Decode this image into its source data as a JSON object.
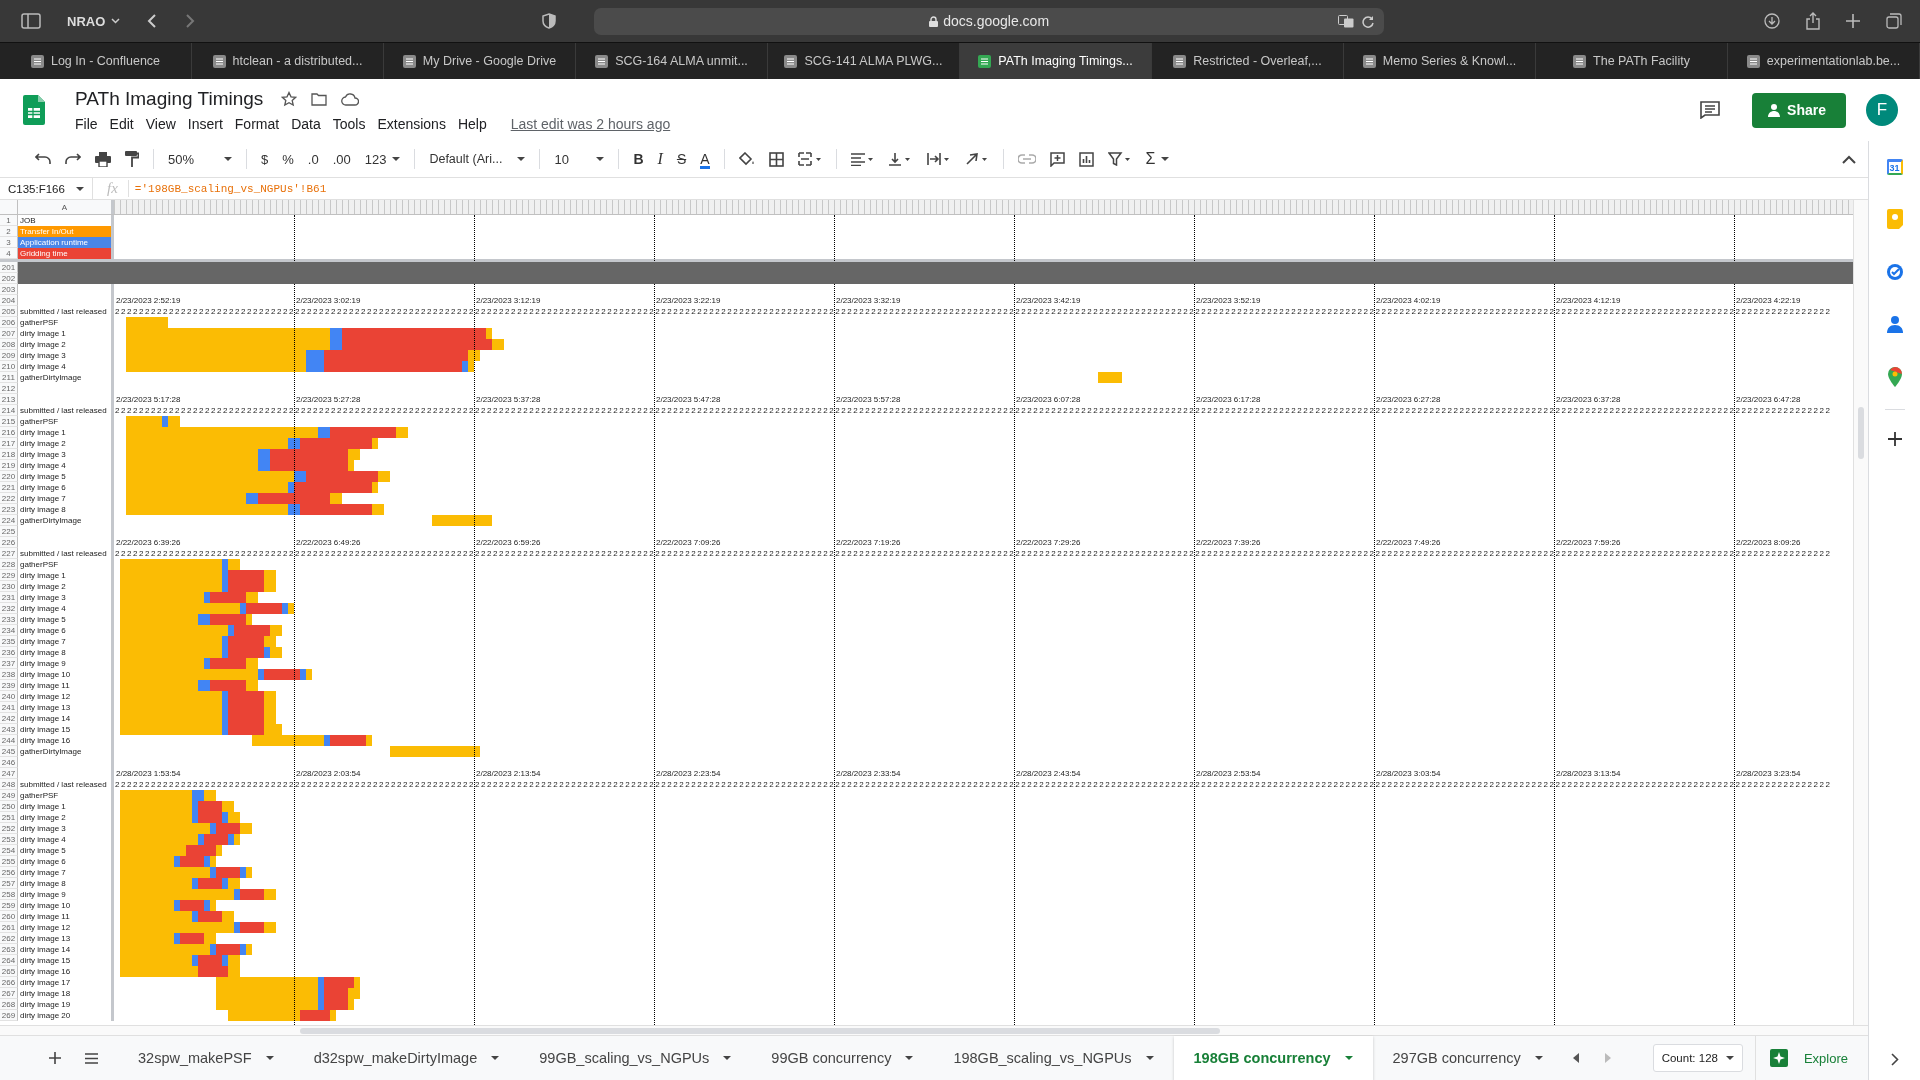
{
  "browser": {
    "profile": "NRAO",
    "url": "docs.google.com",
    "tabs": [
      {
        "title": "Log In - Confluence",
        "selected": false
      },
      {
        "title": "htclean - a distributed...",
        "selected": false
      },
      {
        "title": "My Drive - Google Drive",
        "selected": false
      },
      {
        "title": "SCG-164 ALMA unmit...",
        "selected": false
      },
      {
        "title": "SCG-141 ALMA PLWG...",
        "selected": false
      },
      {
        "title": "PATh Imaging Timings...",
        "selected": true
      },
      {
        "title": "Restricted - Overleaf,...",
        "selected": false
      },
      {
        "title": "Memo Series & Knowl...",
        "selected": false
      },
      {
        "title": "The PATh Facility",
        "selected": false
      },
      {
        "title": "experimentationlab.be...",
        "selected": false
      }
    ]
  },
  "doc": {
    "title": "PATh Imaging Timings",
    "menus": [
      "File",
      "Edit",
      "View",
      "Insert",
      "Format",
      "Data",
      "Tools",
      "Extensions",
      "Help"
    ],
    "last_edit": "Last edit was 2 hours ago",
    "share": "Share",
    "avatar": "F"
  },
  "toolbar": {
    "zoom": "50%",
    "currency": "$",
    "percent": "%",
    "dec_less": ".0",
    "dec_more": ".00",
    "number_format": "123",
    "font": "Default (Ari...",
    "font_size": "10",
    "bold": "B",
    "italic": "I",
    "strike": "S",
    "text_color": "A",
    "sum": "Σ"
  },
  "formula_bar": {
    "cell_ref": "C135:F166",
    "fx": "fx",
    "formula": "='198GB_scaling_vs_NGPUs'!B61"
  },
  "sheet": {
    "column_a": "A",
    "legend": [
      {
        "num": "1",
        "label": "JOB"
      },
      {
        "num": "2",
        "label": "Transfer In/Out",
        "color": "#ff9900"
      },
      {
        "num": "3",
        "label": "Application runtime",
        "color": "#4a86e8"
      },
      {
        "num": "4",
        "label": "Gridding time",
        "color": "#ea4335"
      }
    ],
    "top_rows": [
      {
        "num": "201",
        "kind": "band"
      },
      {
        "num": "202",
        "kind": "band"
      },
      {
        "num": "203",
        "kind": "blank"
      }
    ],
    "blocks": [
      {
        "date_row": "204",
        "timestamps": [
          "2/23/2023 2:52:19",
          "2/23/2023 3:02:19",
          "2/23/2023 3:12:19",
          "2/23/2023 3:22:19",
          "2/23/2023 3:32:19",
          "2/23/2023 3:42:19",
          "2/23/2023 3:52:19",
          "2/23/2023 4:02:19",
          "2/23/2023 4:12:19",
          "2/23/2023 4:22:19"
        ],
        "counts_row": "205",
        "counts_label": "submitted / last released",
        "counts": "2 2 2 2 2 2 2 2 2 2 2 2 2 2 2 2 2 2 2 2 2 2 2 2 2 2 2 2 2 2 2 2 2 2 2 2 2 2 2 2 2 2 2 2 2 2 2 2 2 2 2 2 2 2 2 2 2 2 2 2 2 2 2 2 2 2 2 2 2 2 2 2 2 2 2 2 2 2 2 2 2 2 2 2 2 2 2 2 2 2 2 2 2 2 2 2 2 2 2 2 2 2 2 2 2 2 2 2 2 2 2 2 2 2 2 2 2 2 2 2 2 2 2 2 2 2 2 2 2 2 2 2 2 2 2 2 2 2 2 2 2 2 2 2 2 2 2 2 2 2 2 2 2 2 2 2 2 2 2 2 2 2 2 2 2 2 2 2 2 2 2 2 2 2 2 2 2 2 2 2 2 2 2 2 2 2 2 2 2 2 2 2 2 2 2 2 2 2 2 2 2 2 2 2 2 2 2 2 2 2 2 2 2 2 2 2 2 2 2 2 2 2 2 2 2 2 2 2 2 2 2 2 2 2 2 2 2 2 2 2 2 2 2 2 2 2 2 2 2 2 2 2 2 2 2 2 2 2 2 2 2 2 2 2 2 2 2 2 2 2 2 2 2 2 2 2 2 2 2 2 2 2 2 2 2 2",
        "bar_rows": [
          {
            "num": "206",
            "label": "gatherPSF"
          },
          {
            "num": "207",
            "label": "dirty image 1"
          },
          {
            "num": "208",
            "label": "dirty image 2"
          },
          {
            "num": "209",
            "label": "dirty image 3"
          },
          {
            "num": "210",
            "label": "dirty image 4"
          },
          {
            "num": "211",
            "label": "gatherDirtyImage"
          }
        ],
        "blank_row": "212"
      },
      {
        "date_row": "213",
        "timestamps": [
          "2/23/2023 5:17:28",
          "2/23/2023 5:27:28",
          "2/23/2023 5:37:28",
          "2/23/2023 5:47:28",
          "2/23/2023 5:57:28",
          "2/23/2023 6:07:28",
          "2/23/2023 6:17:28",
          "2/23/2023 6:27:28",
          "2/23/2023 6:37:28",
          "2/23/2023 6:47:28"
        ],
        "counts_row": "214",
        "counts_label": "submitted / last released",
        "counts": "2 2 2 2 2 2 2 2 2 2 2 2 2 2 2 2 2 2 2 2 2 2 2 2 2 2 2 2 2 2 2 2 2 2 2 2 2 2 2 2 2 2 2 2 2 2 2 2 2 2 2 2 2 2 2 2 2 2 2 2 2 2 2 2 2 2 2 2 2 2 2 2 2 2 2 2 2 2 2 2 2 2 2 2 2 2 2 2 2 2 2 2 2 2 2 2 2 2 2 2 2 2 2 2 2 2 2 2 2 2 2 2 2 2 2 2 2 2 2 2 2 2 2 2 2 2 2 2 2 2 2 2 2 2 2 2 2 2 2 2 2 2 2 2 2 2 2 2 2 2 2 2 2 2 2 2 2 2 2 2 2 2 2 2 2 2 2 2 2 2 2 2 2 2 2 2 2 2 2 2 2 2 2 2 2 2 2 2 2 2 2 2 2 2 2 2 2 2 2 2 2 2 2 2 2 2 2 2 2 2 2 2 2 2 2 2 2 2 2 2 2 2 2 2 2 2 2 2 2 2 2 2 2 2 2 2 2 2 2 2 2 2 2 2 2 2 2 2 2 2 2 2 2 2 2 2 2 2 2 2 2 2 2 2 2 2 2 2 2 2 2 2 2 2 2 2 2 2 2 2 2 2 2 2 2 2",
        "bar_rows": [
          {
            "num": "215",
            "label": "gatherPSF"
          },
          {
            "num": "216",
            "label": "dirty image 1"
          },
          {
            "num": "217",
            "label": "dirty image 2"
          },
          {
            "num": "218",
            "label": "dirty image 3"
          },
          {
            "num": "219",
            "label": "dirty image 4"
          },
          {
            "num": "220",
            "label": "dirty image 5"
          },
          {
            "num": "221",
            "label": "dirty image 6"
          },
          {
            "num": "222",
            "label": "dirty image 7"
          },
          {
            "num": "223",
            "label": "dirty image 8"
          },
          {
            "num": "224",
            "label": "gatherDirtyImage"
          }
        ],
        "blank_row": "225"
      },
      {
        "date_row": "226",
        "timestamps": [
          "2/22/2023 6:39:26",
          "2/22/2023 6:49:26",
          "2/22/2023 6:59:26",
          "2/22/2023 7:09:26",
          "2/22/2023 7:19:26",
          "2/22/2023 7:29:26",
          "2/22/2023 7:39:26",
          "2/22/2023 7:49:26",
          "2/22/2023 7:59:26",
          "2/22/2023 8:09:26"
        ],
        "counts_row": "227",
        "counts_label": "submitted / last released",
        "counts": "2 2 2 2 2 2 2 2 2 2 2 2 2 2 2 2 2 2 2 2 2 2 2 2 2 2 2 2 2 2 2 2 2 2 2 2 2 2 2 2 2 2 2 2 2 2 2 2 2 2 2 2 2 2 2 2 2 2 2 2 2 2 2 2 2 2 2 2 2 2 2 2 2 2 2 2 2 2 2 2 2 2 2 2 2 2 2 2 2 2 2 2 2 2 2 2 2 2 2 2 2 2 2 2 2 2 2 2 2 2 2 2 2 2 2 2 2 2 2 2 2 2 2 2 2 2 2 2 2 2 2 2 2 2 2 2 2 2 2 2 2 2 2 2 2 2 2 2 2 2 2 2 2 2 2 2 2 2 2 2 2 2 2 2 2 2 2 2 2 2 2 2 2 2 2 2 2 2 2 2 2 2 2 2 2 2 2 2 2 2 2 2 2 2 2 2 2 2 2 2 2 2 2 2 2 2 2 2 2 2 2 2 2 2 2 2 2 2 2 2 2 2 2 2 2 2 2 2 2 2 2 2 2 2 2 2 2 2 2 2 2 2 2 2 2 2 2 2 2 2 2 2 2 2 2 2 2 2 2 2 2 2 2 2 2 2 2 2 2 2 2 2 2 2 2 2 2 2 2 2 2 2 2 2 2 2",
        "bar_rows": [
          {
            "num": "228",
            "label": "gatherPSF"
          },
          {
            "num": "229",
            "label": "dirty image 1"
          },
          {
            "num": "230",
            "label": "dirty image 2"
          },
          {
            "num": "231",
            "label": "dirty image 3"
          },
          {
            "num": "232",
            "label": "dirty image 4"
          },
          {
            "num": "233",
            "label": "dirty image 5"
          },
          {
            "num": "234",
            "label": "dirty image 6"
          },
          {
            "num": "235",
            "label": "dirty image 7"
          },
          {
            "num": "236",
            "label": "dirty image 8"
          },
          {
            "num": "237",
            "label": "dirty image 9"
          },
          {
            "num": "238",
            "label": "dirty image 10"
          },
          {
            "num": "239",
            "label": "dirty image 11"
          },
          {
            "num": "240",
            "label": "dirty image 12"
          },
          {
            "num": "241",
            "label": "dirty image 13"
          },
          {
            "num": "242",
            "label": "dirty image 14"
          },
          {
            "num": "243",
            "label": "dirty image 15"
          },
          {
            "num": "244",
            "label": "dirty image 16"
          },
          {
            "num": "245",
            "label": "gatherDirtyImage"
          }
        ],
        "blank_row": "246"
      },
      {
        "date_row": "247",
        "timestamps": [
          "2/28/2023 1:53:54",
          "2/28/2023 2:03:54",
          "2/28/2023 2:13:54",
          "2/28/2023 2:23:54",
          "2/28/2023 2:33:54",
          "2/28/2023 2:43:54",
          "2/28/2023 2:53:54",
          "2/28/2023 3:03:54",
          "2/28/2023 3:13:54",
          "2/28/2023 3:23:54"
        ],
        "counts_row": "248",
        "counts_label": "submitted / last released",
        "counts": "2 2 2 2 2 2 2 2 2 2 2 2 2 2 2 2 2 2 2 2 2 2 2 2 2 2 2 2 2 2 2 2 2 2 2 2 2 2 2 2 2 2 2 2 2 2 2 2 2 2 2 2 2 2 2 2 2 2 2 2 2 2 2 2 2 2 2 2 2 2 2 2 2 2 2 2 2 2 2 2 2 2 2 2 2 2 2 2 2 2 2 2 2 2 2 2 2 2 2 2 2 2 2 2 2 2 2 2 2 2 2 2 2 2 2 2 2 2 2 2 2 2 2 2 2 2 2 2 2 2 2 2 2 2 2 2 2 2 2 2 2 2 2 2 2 2 2 2 2 2 2 2 2 2 2 2 2 2 2 2 2 2 2 2 2 2 2 2 2 2 2 2 2 2 2 2 2 2 2 2 2 2 2 2 2 2 2 2 2 2 2 2 2 2 2 2 2 2 2 2 2 2 2 2 2 2 2 2 2 2 2 2 2 2 2 2 2 2 2 2 2 2 2 2 2 2 2 2 2 2 2 2 2 2 2 2 2 2 2 2 2 2 2 2 2 2 2 2 2 2 2 2 2 2 2 2 2 2 2 2 2 2 2 2 2 2 2 2 2 2 2 2 2 2 2 2 2 2 2 2 2 2 2 2 2 2",
        "bar_rows": [
          {
            "num": "249",
            "label": "gatherPSF"
          },
          {
            "num": "250",
            "label": "dirty image 1"
          },
          {
            "num": "251",
            "label": "dirty image 2"
          },
          {
            "num": "252",
            "label": "dirty image 3"
          },
          {
            "num": "253",
            "label": "dirty image 4"
          },
          {
            "num": "254",
            "label": "dirty image 5"
          },
          {
            "num": "255",
            "label": "dirty image 6"
          },
          {
            "num": "256",
            "label": "dirty image 7"
          },
          {
            "num": "257",
            "label": "dirty image 8"
          },
          {
            "num": "258",
            "label": "dirty image 9"
          },
          {
            "num": "259",
            "label": "dirty image 10"
          },
          {
            "num": "260",
            "label": "dirty image 11"
          },
          {
            "num": "261",
            "label": "dirty image 12"
          },
          {
            "num": "262",
            "label": "dirty image 13"
          },
          {
            "num": "263",
            "label": "dirty image 14"
          },
          {
            "num": "264",
            "label": "dirty image 15"
          },
          {
            "num": "265",
            "label": "dirty image 16"
          },
          {
            "num": "266",
            "label": "dirty image 17"
          },
          {
            "num": "267",
            "label": "dirty image 18"
          },
          {
            "num": "268",
            "label": "dirty image 19"
          },
          {
            "num": "269",
            "label": "dirty image 20"
          }
        ]
      }
    ]
  },
  "sheet_tabs": [
    {
      "label": "32spw_makePSF",
      "selected": false
    },
    {
      "label": "d32spw_makeDirtyImage",
      "selected": false
    },
    {
      "label": "99GB_scaling_vs_NGPUs",
      "selected": false
    },
    {
      "label": "99GB concurrency",
      "selected": false
    },
    {
      "label": "198GB_scaling_vs_NGPUs",
      "selected": false
    },
    {
      "label": "198GB concurrency",
      "selected": true
    },
    {
      "label": "297GB concurrency",
      "selected": false
    }
  ],
  "count": "Count: 128",
  "explore": "Explore",
  "side_panel": {
    "calendar_day": "31"
  }
}
